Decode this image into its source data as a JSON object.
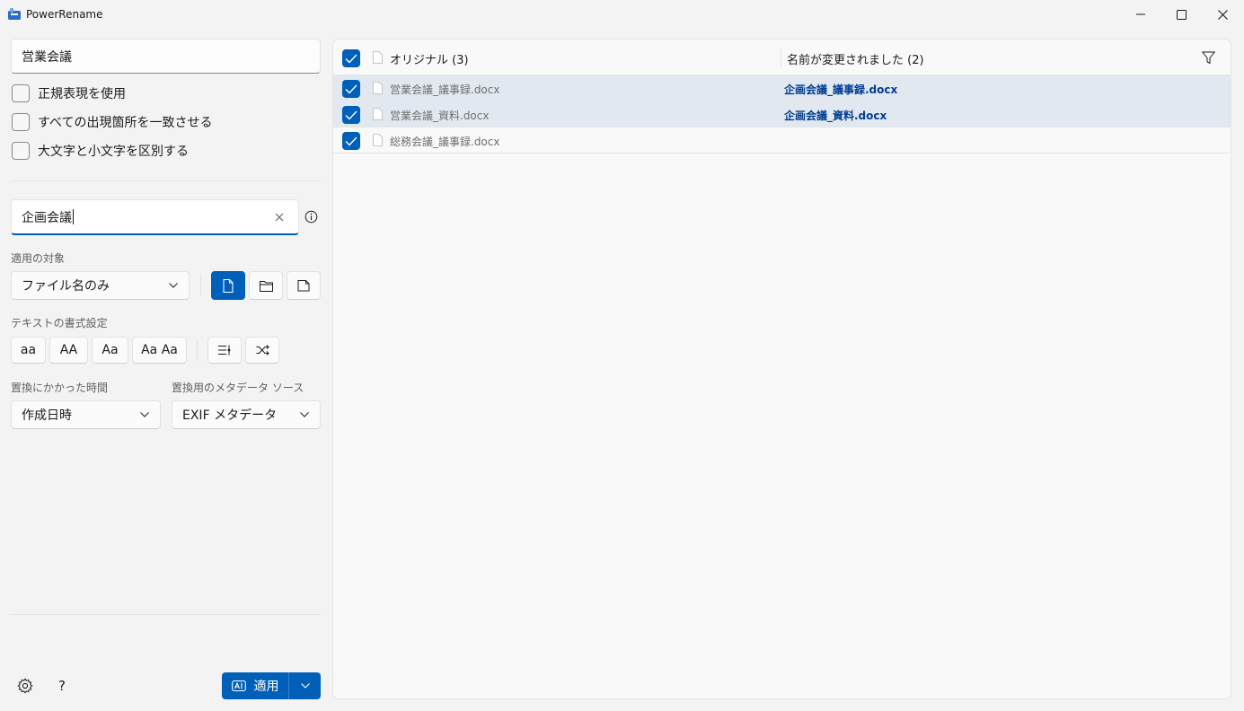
{
  "window": {
    "title": "PowerRename"
  },
  "search": {
    "value": "営業会議",
    "options": [
      {
        "label": "正規表現を使用",
        "checked": false
      },
      {
        "label": "すべての出現箇所を一致させる",
        "checked": false
      },
      {
        "label": "大文字と小文字を区別する",
        "checked": false
      }
    ]
  },
  "replace": {
    "value": "企画会議"
  },
  "apply_to": {
    "label": "適用の対象",
    "selected": "ファイル名のみ",
    "include_files": true,
    "include_folders": false,
    "include_subfolders": false
  },
  "text_format": {
    "label": "テキストの書式設定",
    "buttons": [
      "aa",
      "AA",
      "Aa",
      "Aa Aa"
    ]
  },
  "time": {
    "label": "置換にかかった時間",
    "selected": "作成日時"
  },
  "metadata": {
    "label": "置換用のメタデータ ソース",
    "selected": "EXIF メタデータ"
  },
  "footer": {
    "apply_label": "適用",
    "help_label": "?"
  },
  "list": {
    "original_header": "オリジナル (3)",
    "renamed_header": "名前が変更されました (2)",
    "rows": [
      {
        "original": "営業会議_議事録.docx",
        "renamed": "企画会議_議事録.docx",
        "checked": true,
        "highlighted": true
      },
      {
        "original": "営業会議_資料.docx",
        "renamed": "企画会議_資料.docx",
        "checked": true,
        "highlighted": true
      },
      {
        "original": "総務会議_議事録.docx",
        "renamed": "",
        "checked": true,
        "highlighted": false
      }
    ]
  },
  "colors": {
    "accent": "#005fb8",
    "renamed_text": "#003e92",
    "selected_row": "#e2e8f0"
  }
}
